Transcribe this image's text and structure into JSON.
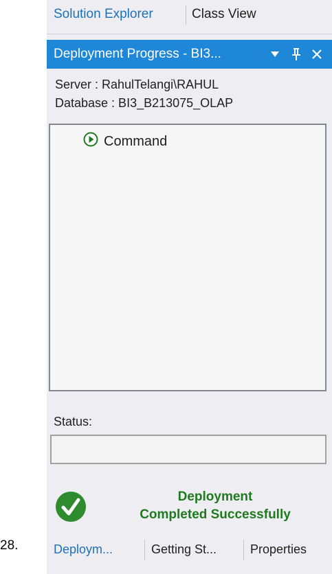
{
  "list_number": "28.",
  "top_tabs": [
    {
      "label": "Solution Explorer",
      "active": true
    },
    {
      "label": "Class View",
      "active": false
    }
  ],
  "panel": {
    "title": "Deployment Progress - BI3...",
    "dropdown_icon": "triangle-down-icon",
    "pin_icon": "pin-icon",
    "close_icon": "close-icon"
  },
  "info": {
    "server": "Server :  RahulTelangi\\RAHUL",
    "database": "Database : BI3_B213075_OLAP"
  },
  "tree": {
    "items": [
      {
        "label": "Command",
        "icon": "play-circle-icon"
      }
    ]
  },
  "status": {
    "label": "Status:",
    "value": ""
  },
  "result": {
    "line1": "Deployment",
    "line2": "Completed Successfully",
    "icon": "check-circle-icon",
    "color": "#2e8b2e"
  },
  "bottom_tabs": [
    {
      "label": "Deploym...",
      "active": true
    },
    {
      "label": "Getting St...",
      "active": false
    },
    {
      "label": "Properties",
      "active": false
    }
  ],
  "colors": {
    "accent": "#1e87d7",
    "tab_active_text": "#1e70b9",
    "panel_bg": "#eeeef2"
  }
}
